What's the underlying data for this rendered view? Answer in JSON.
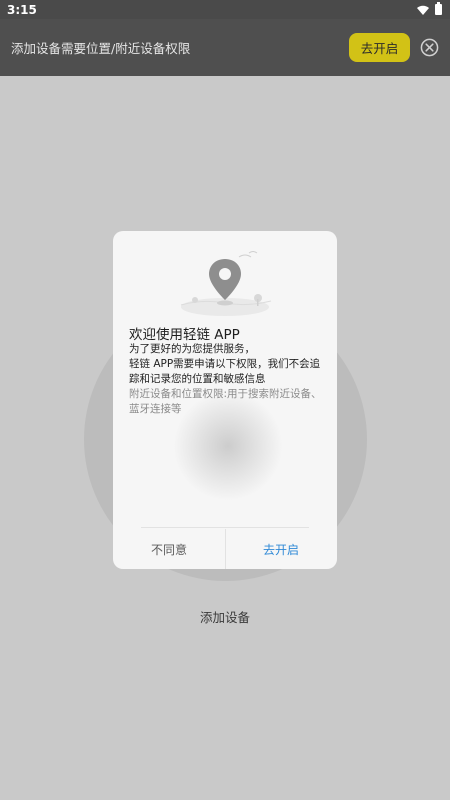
{
  "status_bar": {
    "time": "3:15"
  },
  "permission_banner": {
    "message": "添加设备需要位置/附近设备权限",
    "open_label": "去开启"
  },
  "main": {
    "add_device_label": "添加设备"
  },
  "dialog": {
    "title": "欢迎使用轻链 APP",
    "line1": "为了更好的为您提供服务，",
    "line2": "轻链 APP需要申请以下权限，我们不会追踪和记录您的位置和敏感信息",
    "line3": "附近设备和位置权限:用于搜索附近设备、蓝牙连接等",
    "disagree_label": "不同意",
    "agree_label": "去开启"
  },
  "colors": {
    "banner_bg": "#4f4f4f",
    "banner_button": "#d2c216",
    "agree_text": "#2f89d6",
    "page_bg": "#c9c9c9"
  }
}
